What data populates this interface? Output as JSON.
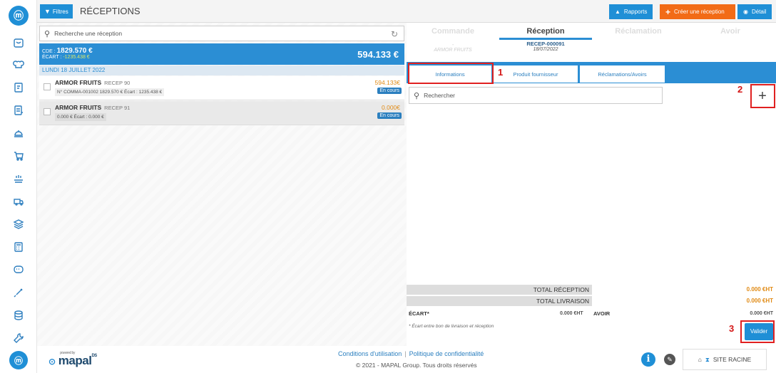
{
  "topbar": {
    "filter_label": "Filtres",
    "page_title": "RÉCEPTIONS",
    "reports_label": "Rapports",
    "create_label": "Créer une réception",
    "detail_label": "Détail",
    "colors": {
      "blue": "#1f8fd6",
      "orange": "#f26b16"
    }
  },
  "left": {
    "search_placeholder": "Recherche une réception",
    "summary": {
      "cde_prefix": "CDE :",
      "cde_value": "1829.570 €",
      "ecart_prefix": "ÉCART :",
      "ecart_value": "-1235.438 €",
      "total": "594.133 €"
    },
    "day_header": "LUNDI 18 JUILLET 2022",
    "receptions": [
      {
        "supplier": "ARMOR FRUITS",
        "ref": "RECEP 90",
        "details": "N° COMMA-001002  1829.570 €  Écart : 1235.438 €",
        "amount": "594.133€",
        "status": "En cours"
      },
      {
        "supplier": "ARMOR FRUITS",
        "ref": "RECEP 91",
        "details": "0.000 €  Écart : 0.000 €",
        "amount": "0.000€",
        "status": "En cours"
      }
    ]
  },
  "right": {
    "tabs": [
      "Commande",
      "Réception",
      "Réclamation",
      "Avoir"
    ],
    "active_tab": "Réception",
    "commande_meta": {
      "line1": "-",
      "line2": "ARMOR FRUITS"
    },
    "reception_meta": {
      "id": "RECEP-000091",
      "date": "18/07/2022"
    },
    "subtabs": [
      "Informations",
      "Produit fournisseur",
      "Réclamations/Avoirs"
    ],
    "search_placeholder": "Rechercher",
    "add_icon": "+",
    "totals": {
      "total_reception_label": "TOTAL RÉCEPTION",
      "total_reception_value": "0.000 €HT",
      "total_livraison_label": "TOTAL LIVRAISON",
      "total_livraison_value": "0.000 €HT",
      "ecart_label": "ÉCART*",
      "ecart_value": "0.000 €HT",
      "avoir_label": "AVOIR",
      "avoir_value": "0.000 €HT"
    },
    "footnote": "* Écart entre bon de livraison et réception",
    "validate_label": "Valider",
    "annotations": [
      "1",
      "2",
      "3"
    ]
  },
  "footer": {
    "powered_by": "powered by",
    "brand": "mapal",
    "brand_suffix": "DS",
    "terms_link": "Conditions d'utilisation",
    "privacy_link": "Politique de confidentialité",
    "separator": "|",
    "copyright": "© 2021 - MAPAL Group. Tous droits réservés",
    "site_label": "SITE RACINE"
  },
  "sidebar": {
    "logo": "ⓜ",
    "icons": [
      "order-icon",
      "chef-hat-icon",
      "recipe-icon",
      "invoice-icon",
      "cloche-icon",
      "cart-icon",
      "dish-icon",
      "truck-icon",
      "stock-icon",
      "calculator-icon",
      "chat-icon",
      "syringe-icon",
      "database-icon",
      "wrench-icon"
    ]
  }
}
